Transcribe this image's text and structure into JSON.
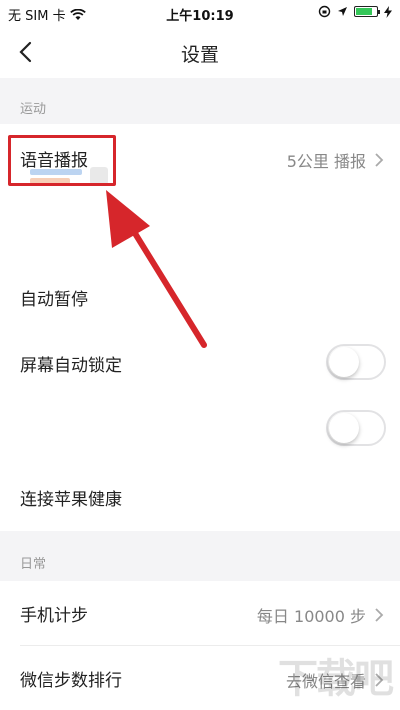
{
  "status_bar": {
    "carrier": "无 SIM 卡",
    "time": "上午10:19"
  },
  "nav": {
    "title": "设置"
  },
  "sections": {
    "sport": {
      "header": "运动",
      "rows": {
        "voice": {
          "label": "语音播报",
          "value": "5公里 播报"
        },
        "auto_pause": {
          "label": "自动暂停"
        },
        "screen_lock": {
          "label": "屏幕自动锁定"
        },
        "apple_health": {
          "label": "连接苹果健康"
        }
      }
    },
    "daily": {
      "header": "日常",
      "rows": {
        "pedometer": {
          "label": "手机计步",
          "value": "每日 10000 步"
        },
        "wechat_rank": {
          "label": "微信步数排行",
          "value": "去微信查看"
        }
      }
    }
  },
  "watermark": "下载吧",
  "colors": {
    "highlight": "#d6262b",
    "section_bg": "#f4f4f6",
    "battery": "#35c759"
  }
}
